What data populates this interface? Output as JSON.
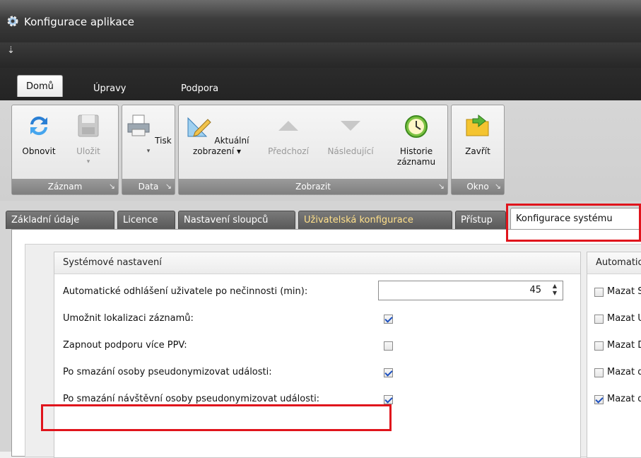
{
  "window": {
    "title": "Konfigurace aplikace",
    "qat_glyph": "⇣"
  },
  "ribbon_tabs": [
    {
      "label": "Domů",
      "active": true
    },
    {
      "label": "Úpravy",
      "active": false
    },
    {
      "label": "Podpora",
      "active": false
    }
  ],
  "ribbon": {
    "groups": {
      "zaznam": "Záznam",
      "data": "Data",
      "zobrazit": "Zobrazit",
      "okno": "Okno"
    },
    "buttons": {
      "obnovit": "Obnovit",
      "ulozit": "Uložit",
      "tisk": "Tisk",
      "aktualni_1": "Aktuální",
      "aktualni_2": "zobrazení ▾",
      "predchozi": "Předchozí",
      "nasledujici": "Následující",
      "historie_1": "Historie",
      "historie_2": "záznamu",
      "zavrit": "Zavřít"
    },
    "launcher_glyph": "↘"
  },
  "page_tabs": [
    {
      "label": "Základní údaje"
    },
    {
      "label": "Licence"
    },
    {
      "label": "Nastavení sloupců"
    },
    {
      "label": "Uživatelská konfigurace"
    },
    {
      "label": "Přístup"
    },
    {
      "label": "Konfigurace systému"
    }
  ],
  "system_settings": {
    "header": "Systémové nastavení",
    "auto_logout_label": "Automatické odhlášení uživatele po nečinnosti (min):",
    "auto_logout_value": "45",
    "rows": [
      {
        "label": "Umožnit lokalizaci záznamů:",
        "checked": true
      },
      {
        "label": "Zapnout podporu více PPV:",
        "checked": false
      },
      {
        "label": "Po smazání osoby pseudonymizovat události:",
        "checked": true
      },
      {
        "label": "Po smazání návštěvní osoby pseudonymizovat události:",
        "checked": true
      }
    ]
  },
  "auto_panel": {
    "header": "Automatické",
    "rows": [
      {
        "label": "Mazat Sy",
        "checked": false
      },
      {
        "label": "Mazat Uc",
        "checked": false
      },
      {
        "label": "Mazat Do",
        "checked": false
      },
      {
        "label": "Mazat da",
        "checked": false
      },
      {
        "label": "Mazat da",
        "checked": true
      }
    ]
  },
  "colors": {
    "highlight": "#e0141c",
    "titlebar": "#3c3c3c",
    "check": "#1b4fbf"
  }
}
